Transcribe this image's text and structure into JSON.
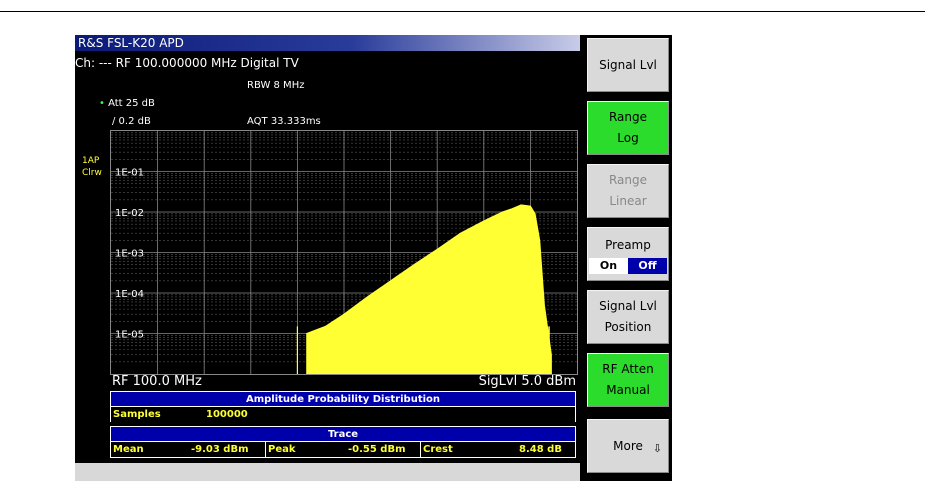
{
  "header": {
    "title": "R&S FSL-K20 APD",
    "channel_line": "Ch: ---  RF 100.000000 MHz  Digital TV",
    "rbw": "RBW 8 MHz",
    "att": "Att  25 dB",
    "ref_step": "/ 0.2 dB",
    "aqt": "AQT 33.333ms",
    "trace_label": "1AP",
    "trace_mode": "Clrw"
  },
  "chart_data": {
    "type": "area",
    "y_scale": "log",
    "y_tick_labels": [
      "1E-01",
      "1E-02",
      "1E-03",
      "1E-04",
      "1E-05"
    ],
    "ylim": [
      1e-06,
      1
    ],
    "xlabel_left": "RF 100.0 MHz",
    "xlabel_right": "SigLvl 5.0 dBm",
    "grid": true,
    "color": "#ffff33",
    "series": [
      {
        "x": [
          0.42,
          0.46,
          0.5,
          0.55,
          0.6,
          0.65,
          0.7,
          0.75,
          0.8,
          0.84,
          0.86,
          0.88,
          0.9,
          0.91,
          0.92,
          0.93,
          0.945
        ],
        "values": [
          1e-05,
          1.5e-05,
          3e-05,
          8e-05,
          0.0002,
          0.0005,
          0.0012,
          0.003,
          0.006,
          0.01,
          0.012,
          0.015,
          0.014,
          0.009,
          0.002,
          5e-05,
          3e-06
        ]
      }
    ]
  },
  "table": {
    "title": "Amplitude Probability Distribution",
    "samples_label": "Samples",
    "samples_value": "100000",
    "trace_title": "Trace",
    "mean_label": "Mean",
    "mean_value": "-9.03 dBm",
    "peak_label": "Peak",
    "peak_value": "-0.55 dBm",
    "crest_label": "Crest",
    "crest_value": "8.48 dB"
  },
  "softkeys": [
    {
      "line1": "Signal Lvl",
      "line2": "",
      "state": "normal"
    },
    {
      "line1": "Range",
      "line2": "Log",
      "state": "active"
    },
    {
      "line1": "Range",
      "line2": "Linear",
      "state": "disabled"
    },
    {
      "line1": "Preamp",
      "on": "On",
      "off": "Off",
      "state": "toggle"
    },
    {
      "line1": "Signal Lvl",
      "line2": "Position",
      "state": "normal"
    },
    {
      "line1": "RF Atten",
      "line2": "Manual",
      "state": "active"
    },
    {
      "line1": "More",
      "arrow": "⇩",
      "state": "normal"
    }
  ],
  "colors": {
    "trace": "#ffff33",
    "softkey_active": "#2cdc2c",
    "table_bar": "#0000aa"
  }
}
